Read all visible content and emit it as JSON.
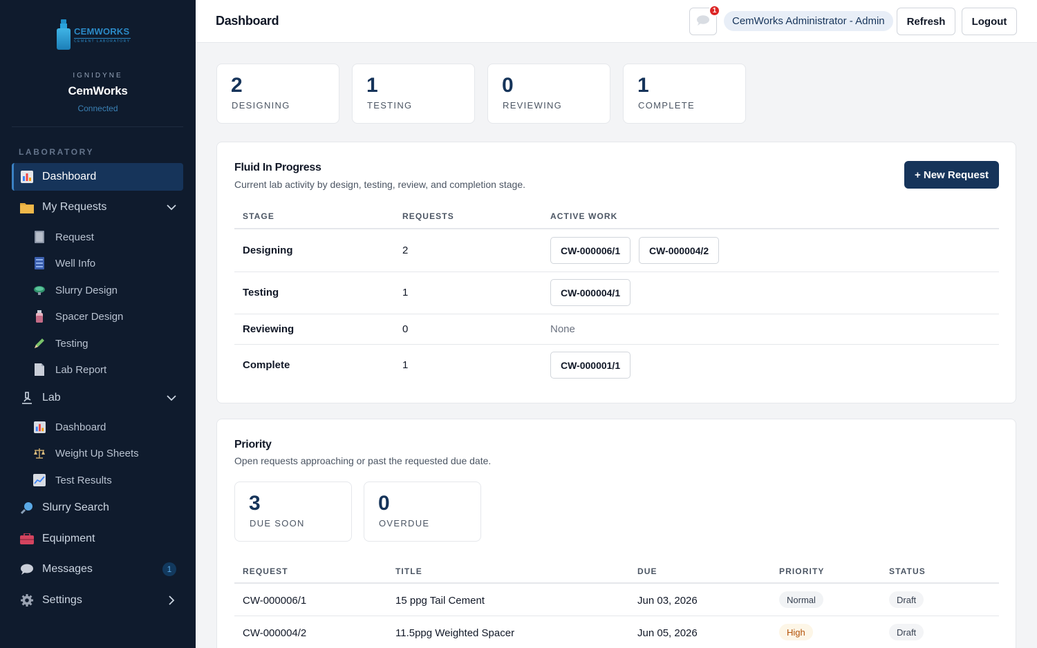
{
  "sidebar": {
    "logo_text": "CEMWORKS",
    "logo_sub": "CEMENT LABORATORY",
    "brand_top": "IGNIDYNE",
    "brand_name": "CemWorks",
    "brand_status": "Connected",
    "section_label": "LABORATORY",
    "items": {
      "dashboard": "Dashboard",
      "my_requests": "My Requests",
      "request": "Request",
      "well_info": "Well Info",
      "slurry_design": "Slurry Design",
      "spacer_design": "Spacer Design",
      "testing": "Testing",
      "lab_report": "Lab Report",
      "lab": "Lab",
      "lab_dashboard": "Dashboard",
      "weight_up": "Weight Up Sheets",
      "test_results": "Test Results",
      "slurry_search": "Slurry Search",
      "equipment": "Equipment",
      "messages": "Messages",
      "messages_count": "1",
      "settings": "Settings"
    }
  },
  "header": {
    "title": "Dashboard",
    "notification_count": "1",
    "user": "CemWorks Administrator - Admin",
    "refresh": "Refresh",
    "logout": "Logout"
  },
  "stats": [
    {
      "value": "2",
      "label": "DESIGNING"
    },
    {
      "value": "1",
      "label": "TESTING"
    },
    {
      "value": "0",
      "label": "REVIEWING"
    },
    {
      "value": "1",
      "label": "COMPLETE"
    }
  ],
  "progress": {
    "title": "Fluid In Progress",
    "description": "Current lab activity by design, testing, review, and completion stage.",
    "new_request": "+ New Request",
    "columns": {
      "stage": "STAGE",
      "requests": "REQUESTS",
      "active": "ACTIVE WORK"
    },
    "rows": [
      {
        "stage": "Designing",
        "count": "2",
        "work": [
          "CW-000006/1",
          "CW-000004/2"
        ]
      },
      {
        "stage": "Testing",
        "count": "1",
        "work": [
          "CW-000004/1"
        ]
      },
      {
        "stage": "Reviewing",
        "count": "0",
        "none": "None"
      },
      {
        "stage": "Complete",
        "count": "1",
        "work": [
          "CW-000001/1"
        ]
      }
    ]
  },
  "priority": {
    "title": "Priority",
    "description": "Open requests approaching or past the requested due date.",
    "cards": [
      {
        "value": "3",
        "label": "DUE SOON"
      },
      {
        "value": "0",
        "label": "OVERDUE"
      }
    ],
    "columns": {
      "request": "REQUEST",
      "title": "TITLE",
      "due": "DUE",
      "priority": "PRIORITY",
      "status": "STATUS"
    },
    "rows": [
      {
        "request": "CW-000006/1",
        "title": "15 ppg Tail Cement",
        "due": "Jun 03, 2026",
        "priority": "Normal",
        "status": "Draft"
      },
      {
        "request": "CW-000004/2",
        "title": "11.5ppg Weighted Spacer",
        "due": "Jun 05, 2026",
        "priority": "High",
        "status": "Draft"
      }
    ]
  },
  "colors": {
    "sidebar_bg": "#0f1b2d",
    "accent": "#16345a",
    "badge": "#dc2626"
  }
}
